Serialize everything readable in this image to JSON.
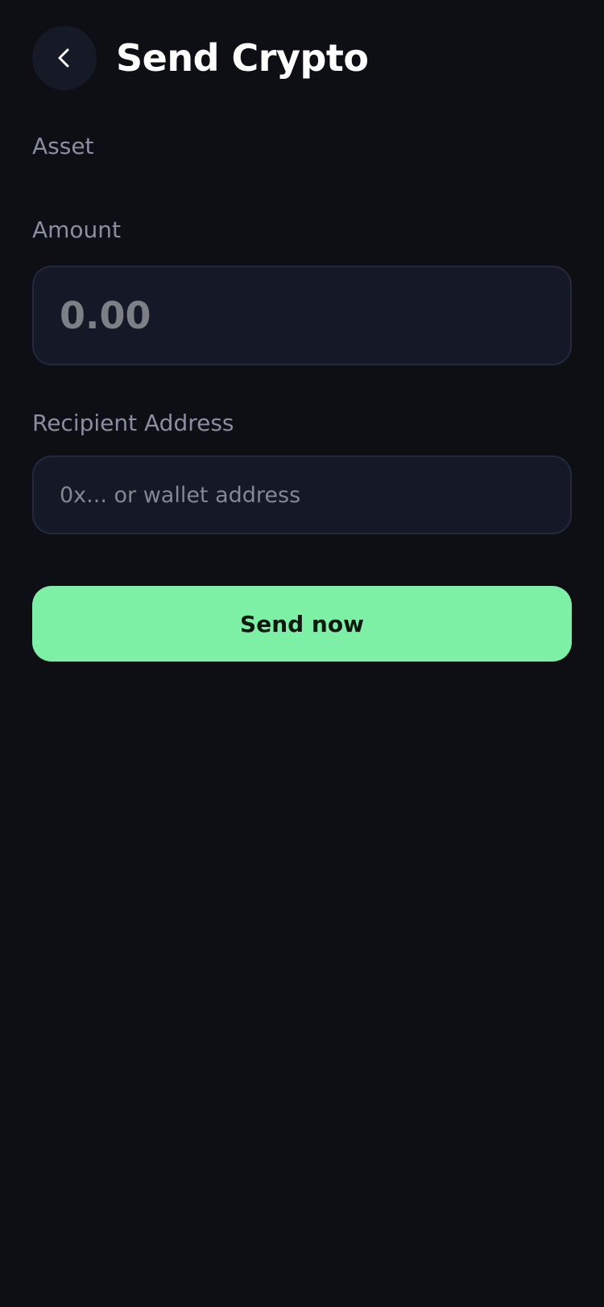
{
  "header": {
    "title": "Send Crypto",
    "back_icon": "chevron-left-icon"
  },
  "form": {
    "asset_label": "Asset",
    "amount_label": "Amount",
    "amount_placeholder": "0.00",
    "recipient_label": "Recipient Address",
    "recipient_placeholder": "0x... or wallet address",
    "submit_label": "Send now"
  },
  "colors": {
    "background": "#0e0f14",
    "field_background": "#151826",
    "field_border": "#24283a",
    "accent": "#7ef0a5",
    "label_text": "#8a8ea3"
  }
}
